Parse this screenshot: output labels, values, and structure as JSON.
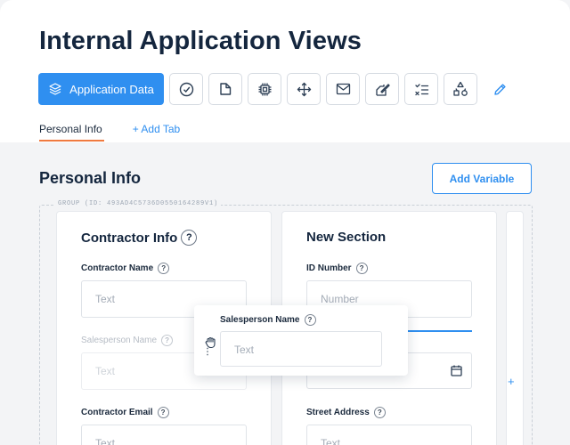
{
  "header": {
    "title": "Internal Application Views"
  },
  "toolbar": {
    "primary_label": "Application Data",
    "icons": [
      "layers-icon",
      "check-circle-icon",
      "document-icon",
      "cpu-icon",
      "move-arrows-icon",
      "mail-icon",
      "signature-icon",
      "checklist-icon",
      "shapes-icon",
      "edit-pencil-icon"
    ]
  },
  "tabs": [
    {
      "label": "Personal Info",
      "active": true
    },
    {
      "label": "+ Add Tab",
      "active": false
    }
  ],
  "section": {
    "title": "Personal Info",
    "add_variable": "Add Variable"
  },
  "group": {
    "label": "GROUP (ID: 493AD4C5736D0550164289V1)"
  },
  "card_left": {
    "title": "Contractor Info",
    "help": "?",
    "fields": [
      {
        "label": "Contractor Name",
        "placeholder": "Text"
      },
      {
        "label": "Salesperson Name",
        "placeholder": "Text"
      },
      {
        "label": "Contractor Email",
        "placeholder": "Text"
      }
    ]
  },
  "card_right": {
    "title": "New Section",
    "fields": [
      {
        "label": "ID Number",
        "placeholder": "Number"
      },
      {
        "label": "Street Address",
        "placeholder": "Text"
      }
    ]
  },
  "dragging": {
    "label": "Salesperson Name",
    "placeholder": "Text"
  },
  "side": {
    "add": "+"
  },
  "colors": {
    "accent": "#2f8ff0",
    "tab_underline": "#f07a3f",
    "title": "#14263e"
  }
}
